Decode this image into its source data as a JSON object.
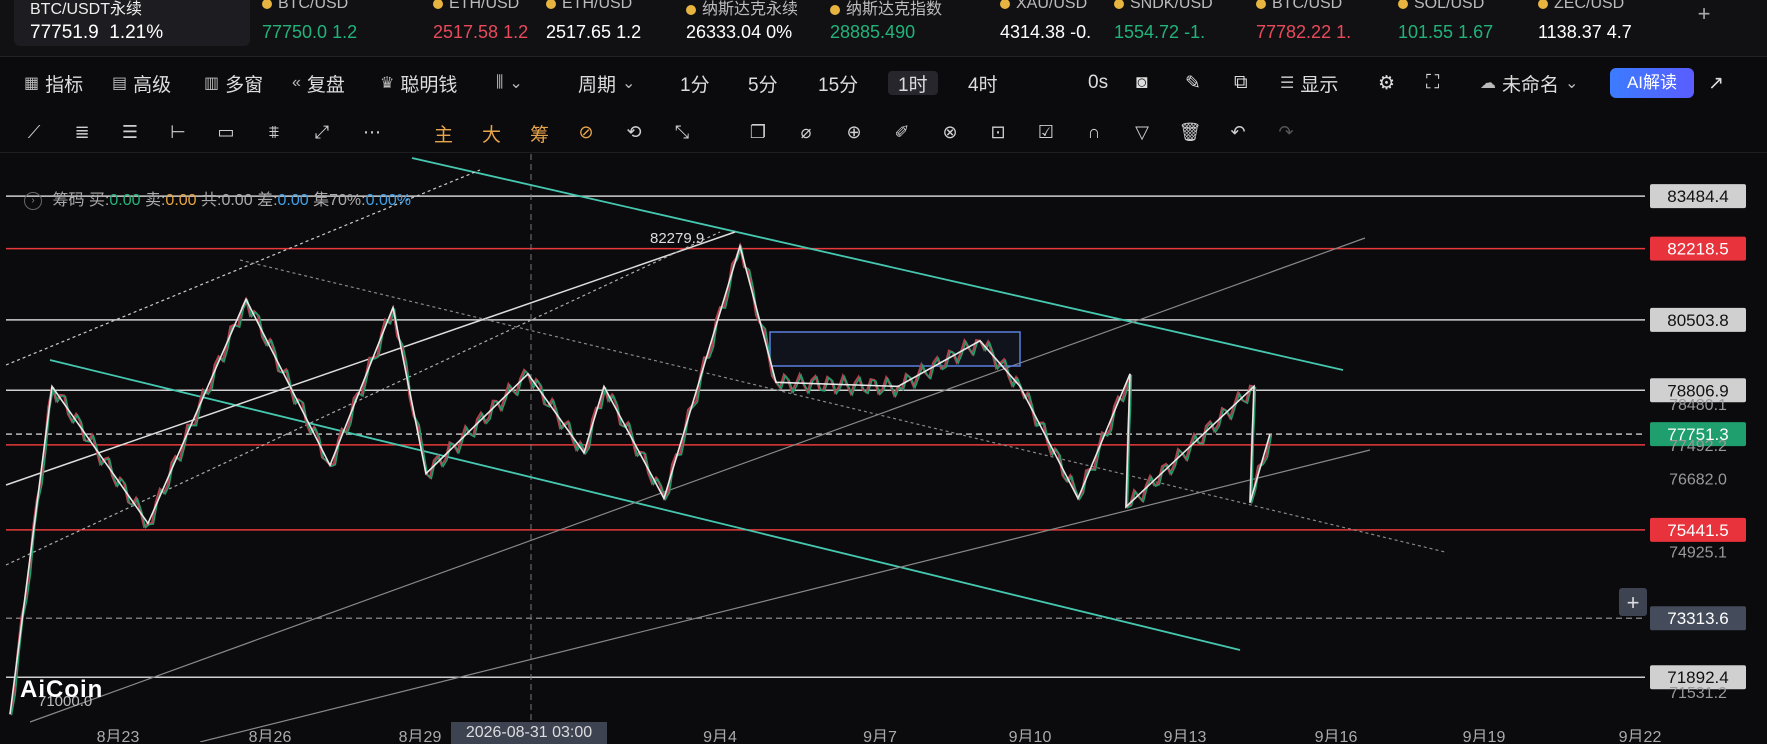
{
  "tickers": [
    {
      "sym": "BTC/USDT永续",
      "price": "77751.9",
      "change": "1.21%",
      "main": true
    },
    {
      "sym": "BTC/USD",
      "price": "77750.0",
      "change": "1.2",
      "color": "#22b37a"
    },
    {
      "sym": "ETH/USD",
      "price": "2517.58",
      "change": "1.2",
      "color": "#e84a5a"
    },
    {
      "sym": "ETH/USD",
      "price": "2517.65",
      "change": "1.2",
      "color": "#ffffff"
    },
    {
      "sym": "纳斯达克永续",
      "price": "26333.04",
      "change": "0%",
      "color": "#ffffff"
    },
    {
      "sym": "纳斯达克指数",
      "price": "28885.490",
      "change": "",
      "color": "#22b37a"
    },
    {
      "sym": "XAU/USD",
      "price": "4314.38",
      "change": "-0.",
      "color": "#ffffff"
    },
    {
      "sym": "SNDK/USD",
      "price": "1554.72",
      "change": "-1.",
      "color": "#22b37a"
    },
    {
      "sym": "BTC/USD",
      "price": "77782.22",
      "change": "1.",
      "color": "#e84a5a"
    },
    {
      "sym": "SOL/USD",
      "price": "101.55",
      "change": "1.67",
      "color": "#22b37a"
    },
    {
      "sym": "ZEC/USD",
      "price": "1138.37",
      "change": "4.7",
      "color": "#ffffff"
    }
  ],
  "toolbar": {
    "indicators": "指标",
    "advanced": "高级",
    "multi_window": "多窗",
    "replay": "复盘",
    "smart_money": "聪明钱",
    "period": "周期",
    "p1": "1分",
    "p5": "5分",
    "p15": "15分",
    "p1h": "1时",
    "p4h": "4时",
    "countdown": "0s",
    "display": "显示",
    "unnamed": "未命名",
    "ai": "AI解读"
  },
  "toolbar2": {
    "main": "主",
    "big": "大",
    "chips": "筹"
  },
  "legend": {
    "prefix": "筹码",
    "buy_label": "买:",
    "buy": "0.00",
    "sell_label": "卖:",
    "sell": "0.00",
    "total_label": "共:0.00",
    "diff_label": "差:",
    "diff": "0.00",
    "conc_label": "集70%:",
    "conc": "0.00%"
  },
  "watermark": "AiCoin",
  "colors": {
    "up": "#22b37a",
    "down": "#e84a5a",
    "level_red": "#e83a3a",
    "channel": "#46c8b0"
  },
  "chart_data": {
    "type": "line",
    "title": "",
    "x": [
      "8月23",
      "8月26",
      "8月29",
      "9月4",
      "9月7",
      "9月10",
      "9月13",
      "9月16",
      "9月19",
      "9月22"
    ],
    "crosshair_x": "2026-08-31 03:00",
    "ylim": [
      70500,
      84500
    ],
    "price_labels": [
      {
        "value": "83484.4",
        "kind": "white"
      },
      {
        "value": "82218.5",
        "kind": "red"
      },
      {
        "value": "80503.8",
        "kind": "white"
      },
      {
        "value": "78806.9",
        "kind": "white"
      },
      {
        "value": "78480.1",
        "kind": "tick"
      },
      {
        "value": "77751.3",
        "kind": "current"
      },
      {
        "value": "77492.2",
        "kind": "tick"
      },
      {
        "value": "76682.0",
        "kind": "tick"
      },
      {
        "value": "75441.5",
        "kind": "red"
      },
      {
        "value": "74925.1",
        "kind": "tick"
      },
      {
        "value": "73313.6",
        "kind": "crosshair"
      },
      {
        "value": "71892.4",
        "kind": "white"
      },
      {
        "value": "71531.2",
        "kind": "tick"
      }
    ],
    "peak_annotation": "82279.9",
    "low_annotation": "71000.0",
    "series": [
      {
        "values": [
          71000,
          78900,
          75600,
          81000,
          77000,
          80800,
          76800,
          79200,
          77300,
          78900,
          76200,
          82279.9,
          79000,
          78900,
          80000,
          78900,
          76200,
          79200,
          76000,
          78900,
          76100,
          77751.9
        ]
      }
    ]
  }
}
